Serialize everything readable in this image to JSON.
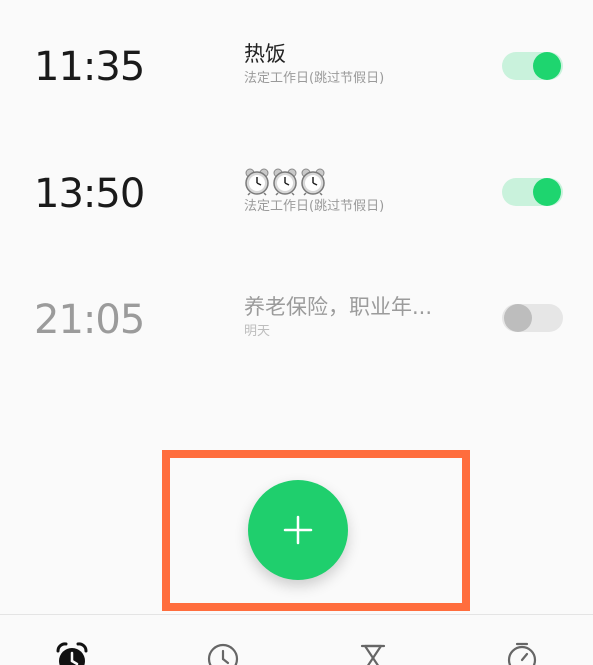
{
  "alarms": [
    {
      "time": "11:35",
      "label": "热饭",
      "repeat": "法定工作日(跳过节假日)",
      "enabled": true
    },
    {
      "time": "13:50",
      "label_icons": [
        "alarm-clock-icon",
        "alarm-clock-icon",
        "alarm-clock-icon"
      ],
      "repeat": "法定工作日(跳过节假日)",
      "enabled": true
    },
    {
      "time": "21:05",
      "label": "养老保险，职业年...",
      "repeat": "明天",
      "enabled": false
    }
  ],
  "fab": {
    "icon": "plus-icon"
  },
  "bottom_nav": [
    {
      "icon": "alarm-icon",
      "active": true
    },
    {
      "icon": "world-clock-icon",
      "active": false
    },
    {
      "icon": "timer-hourglass-icon",
      "active": false
    },
    {
      "icon": "stopwatch-icon",
      "active": false
    }
  ],
  "colors": {
    "accent": "#1ed56f",
    "toggle_track_on": "#c9f2dc",
    "toggle_track_off": "#e6e6e6",
    "highlight": "#ff6d3d"
  }
}
